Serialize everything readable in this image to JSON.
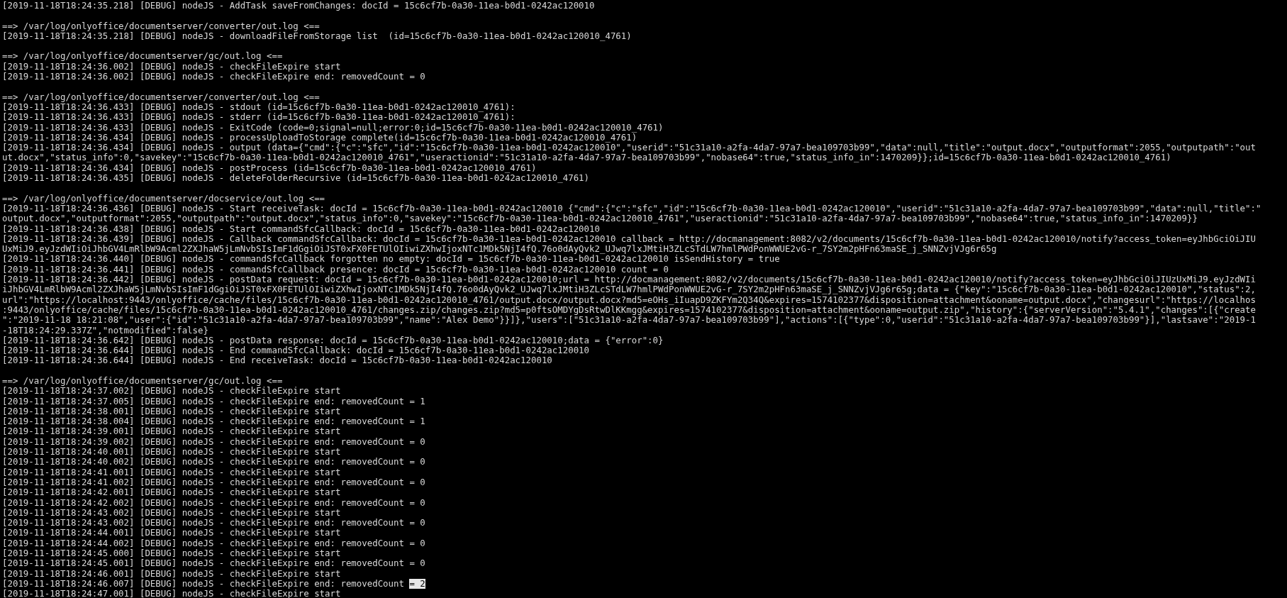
{
  "lines": [
    {
      "kind": "entry",
      "text": "[2019-11-18T18:24:35.218] [DEBUG] nodeJS - AddTask saveFromChanges: docId = 15c6cf7b-0a30-11ea-b0d1-0242ac120010"
    },
    {
      "kind": "blank"
    },
    {
      "kind": "header",
      "text": "==> /var/log/onlyoffice/documentserver/converter/out.log <=="
    },
    {
      "kind": "entry",
      "text": "[2019-11-18T18:24:35.218] [DEBUG] nodeJS - downloadFileFromStorage list  (id=15c6cf7b-0a30-11ea-b0d1-0242ac120010_4761)"
    },
    {
      "kind": "blank"
    },
    {
      "kind": "header",
      "text": "==> /var/log/onlyoffice/documentserver/gc/out.log <=="
    },
    {
      "kind": "entry",
      "text": "[2019-11-18T18:24:36.002] [DEBUG] nodeJS - checkFileExpire start"
    },
    {
      "kind": "entry",
      "text": "[2019-11-18T18:24:36.002] [DEBUG] nodeJS - checkFileExpire end: removedCount = 0"
    },
    {
      "kind": "blank"
    },
    {
      "kind": "header",
      "text": "==> /var/log/onlyoffice/documentserver/converter/out.log <=="
    },
    {
      "kind": "entry",
      "text": "[2019-11-18T18:24:36.433] [DEBUG] nodeJS - stdout (id=15c6cf7b-0a30-11ea-b0d1-0242ac120010_4761):"
    },
    {
      "kind": "entry",
      "text": "[2019-11-18T18:24:36.433] [DEBUG] nodeJS - stderr (id=15c6cf7b-0a30-11ea-b0d1-0242ac120010_4761):"
    },
    {
      "kind": "entry",
      "text": "[2019-11-18T18:24:36.433] [DEBUG] nodeJS - ExitCode (code=0;signal=null;error:0;id=15c6cf7b-0a30-11ea-b0d1-0242ac120010_4761)"
    },
    {
      "kind": "entry",
      "text": "[2019-11-18T18:24:36.434] [DEBUG] nodeJS - processUploadToStorage complete(id=15c6cf7b-0a30-11ea-b0d1-0242ac120010_4761)"
    },
    {
      "kind": "entry",
      "text": "[2019-11-18T18:24:36.434] [DEBUG] nodeJS - output (data={\"cmd\":{\"c\":\"sfc\",\"id\":\"15c6cf7b-0a30-11ea-b0d1-0242ac120010\",\"userid\":\"51c31a10-a2fa-4da7-97a7-bea109703b99\",\"data\":null,\"title\":\"output.docx\",\"outputformat\":2055,\"outputpath\":\"out"
    },
    {
      "kind": "wrap",
      "text": "ut.docx\",\"status_info\":0,\"savekey\":\"15c6cf7b-0a30-11ea-b0d1-0242ac120010_4761\",\"useractionid\":\"51c31a10-a2fa-4da7-97a7-bea109703b99\",\"nobase64\":true,\"status_info_in\":1470209}};id=15c6cf7b-0a30-11ea-b0d1-0242ac120010_4761)"
    },
    {
      "kind": "entry",
      "text": "[2019-11-18T18:24:36.434] [DEBUG] nodeJS - postProcess (id=15c6cf7b-0a30-11ea-b0d1-0242ac120010_4761)"
    },
    {
      "kind": "entry",
      "text": "[2019-11-18T18:24:36.435] [DEBUG] nodeJS - deleteFolderRecursive (id=15c6cf7b-0a30-11ea-b0d1-0242ac120010_4761)"
    },
    {
      "kind": "blank"
    },
    {
      "kind": "header",
      "text": "==> /var/log/onlyoffice/documentserver/docservice/out.log <=="
    },
    {
      "kind": "entry",
      "text": "[2019-11-18T18:24:36.436] [DEBUG] nodeJS - Start receiveTask: docId = 15c6cf7b-0a30-11ea-b0d1-0242ac120010 {\"cmd\":{\"c\":\"sfc\",\"id\":\"15c6cf7b-0a30-11ea-b0d1-0242ac120010\",\"userid\":\"51c31a10-a2fa-4da7-97a7-bea109703b99\",\"data\":null,\"title\":\""
    },
    {
      "kind": "wrap",
      "text": "output.docx\",\"outputformat\":2055,\"outputpath\":\"output.docx\",\"status_info\":0,\"savekey\":\"15c6cf7b-0a30-11ea-b0d1-0242ac120010_4761\",\"useractionid\":\"51c31a10-a2fa-4da7-97a7-bea109703b99\",\"nobase64\":true,\"status_info_in\":1470209}}"
    },
    {
      "kind": "entry",
      "text": "[2019-11-18T18:24:36.438] [DEBUG] nodeJS - Start commandSfcCallback: docId = 15c6cf7b-0a30-11ea-b0d1-0242ac120010"
    },
    {
      "kind": "entry",
      "text": "[2019-11-18T18:24:36.439] [DEBUG] nodeJS - Callback commandSfcCallback: docId = 15c6cf7b-0a30-11ea-b0d1-0242ac120010 callback = http://docmanagement:8082/v2/documents/15c6cf7b-0a30-11ea-b0d1-0242ac120010/notify?access_token=eyJhbGciOiJIU"
    },
    {
      "kind": "wrap",
      "text": "UxMiJ9.eyJzdWIiOiJhbGV4LmRlbW9Acml2ZXJhaW5jLmNvbSIsImF1dGgiOiJST0xFX0FETUlOIiwiZXhwIjoxNTc1MDk5NjI4fQ.76o0dAyQvk2_UJwq7lxJMtiH3ZLcSTdLW7hmlPWdPonWWUE2vG-r_7SY2m2pHFn63maSE_j_SNNZvjVJg6r65g"
    },
    {
      "kind": "entry",
      "text": "[2019-11-18T18:24:36.440] [DEBUG] nodeJS - commandSfcCallback forgotten no empty: docId = 15c6cf7b-0a30-11ea-b0d1-0242ac120010 isSendHistory = true"
    },
    {
      "kind": "entry",
      "text": "[2019-11-18T18:24:36.441] [DEBUG] nodeJS - commandSfcCallback presence: docId = 15c6cf7b-0a30-11ea-b0d1-0242ac120010 count = 0"
    },
    {
      "kind": "entry",
      "text": "[2019-11-18T18:24:36.442] [DEBUG] nodeJS - postData request: docId = 15c6cf7b-0a30-11ea-b0d1-0242ac120010;url = http://docmanagement:8082/v2/documents/15c6cf7b-0a30-11ea-b0d1-0242ac120010/notify?access_token=eyJhbGciOiJIUzUxMiJ9.eyJzdWIi"
    },
    {
      "kind": "wrap",
      "text": "iJhbGV4LmRlbW9Acml2ZXJhaW5jLmNvbSIsImF1dGgiOiJST0xFX0FETUlOIiwiZXhwIjoxNTc1MDk5NjI4fQ.76o0dAyQvk2_UJwq7lxJMtiH3ZLcSTdLW7hmlPWdPonWWUE2vG-r_7SY2m2pHFn63maSE_j_SNNZvjVJg6r65g;data = {\"key\":\"15c6cf7b-0a30-11ea-b0d1-0242ac120010\",\"status\":2,"
    },
    {
      "kind": "wrap",
      "text": "url\":\"https://localhost:9443/onlyoffice/cache/files/15c6cf7b-0a30-11ea-b0d1-0242ac120010_4761/output.docx/output.docx?md5=eOHs_iIuapD9ZKFYm2Q34Q&expires=1574102377&disposition=attachment&ooname=output.docx\",\"changesurl\":\"https://localhos"
    },
    {
      "kind": "wrap",
      "text": ":9443/onlyoffice/cache/files/15c6cf7b-0a30-11ea-b0d1-0242ac120010_4761/changes.zip/changes.zip?md5=p0ftsOMDYgDsRtwDlKKmgg&expires=1574102377&disposition=attachment&ooname=output.zip\",\"history\":{\"serverVersion\":\"5.4.1\",\"changes\":[{\"create"
    },
    {
      "kind": "wrap",
      "text": "\":\"2019-11-18 18:21:08\",\"user\":{\"id\":\"51c31a10-a2fa-4da7-97a7-bea109703b99\",\"name\":\"Alex Demo\"}}]},\"users\":[\"51c31a10-a2fa-4da7-97a7-bea109703b99\"],\"actions\":[{\"type\":0,\"userid\":\"51c31a10-a2fa-4da7-97a7-bea109703b99\"}],\"lastsave\":\"2019-1"
    },
    {
      "kind": "wrap",
      "text": "-18T18:24:29.337Z\",\"notmodified\":false}"
    },
    {
      "kind": "entry",
      "text": "[2019-11-18T18:24:36.642] [DEBUG] nodeJS - postData response: docId = 15c6cf7b-0a30-11ea-b0d1-0242ac120010;data = {\"error\":0}"
    },
    {
      "kind": "entry",
      "text": "[2019-11-18T18:24:36.644] [DEBUG] nodeJS - End commandSfcCallback: docId = 15c6cf7b-0a30-11ea-b0d1-0242ac120010"
    },
    {
      "kind": "entry",
      "text": "[2019-11-18T18:24:36.644] [DEBUG] nodeJS - End receiveTask: docId = 15c6cf7b-0a30-11ea-b0d1-0242ac120010"
    },
    {
      "kind": "blank"
    },
    {
      "kind": "header",
      "text": "==> /var/log/onlyoffice/documentserver/gc/out.log <=="
    },
    {
      "kind": "entry",
      "text": "[2019-11-18T18:24:37.002] [DEBUG] nodeJS - checkFileExpire start"
    },
    {
      "kind": "entry",
      "text": "[2019-11-18T18:24:37.005] [DEBUG] nodeJS - checkFileExpire end: removedCount = 1"
    },
    {
      "kind": "entry",
      "text": "[2019-11-18T18:24:38.001] [DEBUG] nodeJS - checkFileExpire start"
    },
    {
      "kind": "entry",
      "text": "[2019-11-18T18:24:38.004] [DEBUG] nodeJS - checkFileExpire end: removedCount = 1"
    },
    {
      "kind": "entry",
      "text": "[2019-11-18T18:24:39.001] [DEBUG] nodeJS - checkFileExpire start"
    },
    {
      "kind": "entry",
      "text": "[2019-11-18T18:24:39.002] [DEBUG] nodeJS - checkFileExpire end: removedCount = 0"
    },
    {
      "kind": "entry",
      "text": "[2019-11-18T18:24:40.001] [DEBUG] nodeJS - checkFileExpire start"
    },
    {
      "kind": "entry",
      "text": "[2019-11-18T18:24:40.002] [DEBUG] nodeJS - checkFileExpire end: removedCount = 0"
    },
    {
      "kind": "entry",
      "text": "[2019-11-18T18:24:41.001] [DEBUG] nodeJS - checkFileExpire start"
    },
    {
      "kind": "entry",
      "text": "[2019-11-18T18:24:41.002] [DEBUG] nodeJS - checkFileExpire end: removedCount = 0"
    },
    {
      "kind": "entry",
      "text": "[2019-11-18T18:24:42.001] [DEBUG] nodeJS - checkFileExpire start"
    },
    {
      "kind": "entry",
      "text": "[2019-11-18T18:24:42.002] [DEBUG] nodeJS - checkFileExpire end: removedCount = 0"
    },
    {
      "kind": "entry",
      "text": "[2019-11-18T18:24:43.002] [DEBUG] nodeJS - checkFileExpire start"
    },
    {
      "kind": "entry",
      "text": "[2019-11-18T18:24:43.002] [DEBUG] nodeJS - checkFileExpire end: removedCount = 0"
    },
    {
      "kind": "entry",
      "text": "[2019-11-18T18:24:44.001] [DEBUG] nodeJS - checkFileExpire start"
    },
    {
      "kind": "entry",
      "text": "[2019-11-18T18:24:44.002] [DEBUG] nodeJS - checkFileExpire end: removedCount = 0"
    },
    {
      "kind": "entry",
      "text": "[2019-11-18T18:24:45.000] [DEBUG] nodeJS - checkFileExpire start"
    },
    {
      "kind": "entry",
      "text": "[2019-11-18T18:24:45.001] [DEBUG] nodeJS - checkFileExpire end: removedCount = 0"
    },
    {
      "kind": "entry",
      "text": "[2019-11-18T18:24:46.001] [DEBUG] nodeJS - checkFileExpire start"
    },
    {
      "kind": "entry",
      "text": "[2019-11-18T18:24:46.007] [DEBUG] nodeJS - checkFileExpire end: removedCount ",
      "highlight": "= 2"
    },
    {
      "kind": "entry",
      "text": "[2019-11-18T18:24:47.001] [DEBUG] nodeJS - checkFileExpire start"
    }
  ]
}
